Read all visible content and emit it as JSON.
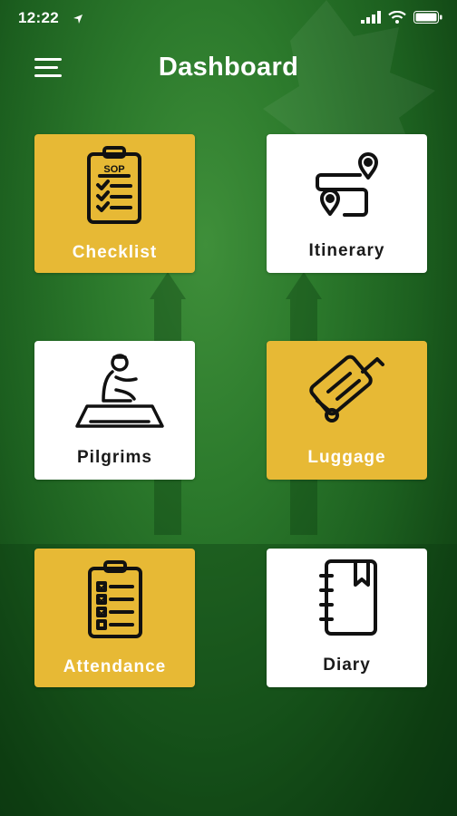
{
  "status_bar": {
    "time": "12:22",
    "icons": [
      "location-arrow-icon",
      "cellular-signal-icon",
      "wifi-icon",
      "battery-icon"
    ]
  },
  "header": {
    "title": "Dashboard",
    "menu_icon": "hamburger-menu-icon"
  },
  "colors": {
    "gold": "#e7b935",
    "white": "#ffffff",
    "green_background": "#2c7a2c"
  },
  "tiles": [
    {
      "label": "Checklist",
      "icon": "sop-clipboard-icon",
      "variant": "gold",
      "icon_text": "SOP"
    },
    {
      "label": "Itinerary",
      "icon": "route-map-icon",
      "variant": "white"
    },
    {
      "label": "Pilgrims",
      "icon": "praying-pilgrim-icon",
      "variant": "white"
    },
    {
      "label": "Luggage",
      "icon": "luggage-icon",
      "variant": "gold"
    },
    {
      "label": "Attendance",
      "icon": "attendance-clipboard-icon",
      "variant": "gold"
    },
    {
      "label": "Diary",
      "icon": "diary-notebook-icon",
      "variant": "white"
    }
  ]
}
